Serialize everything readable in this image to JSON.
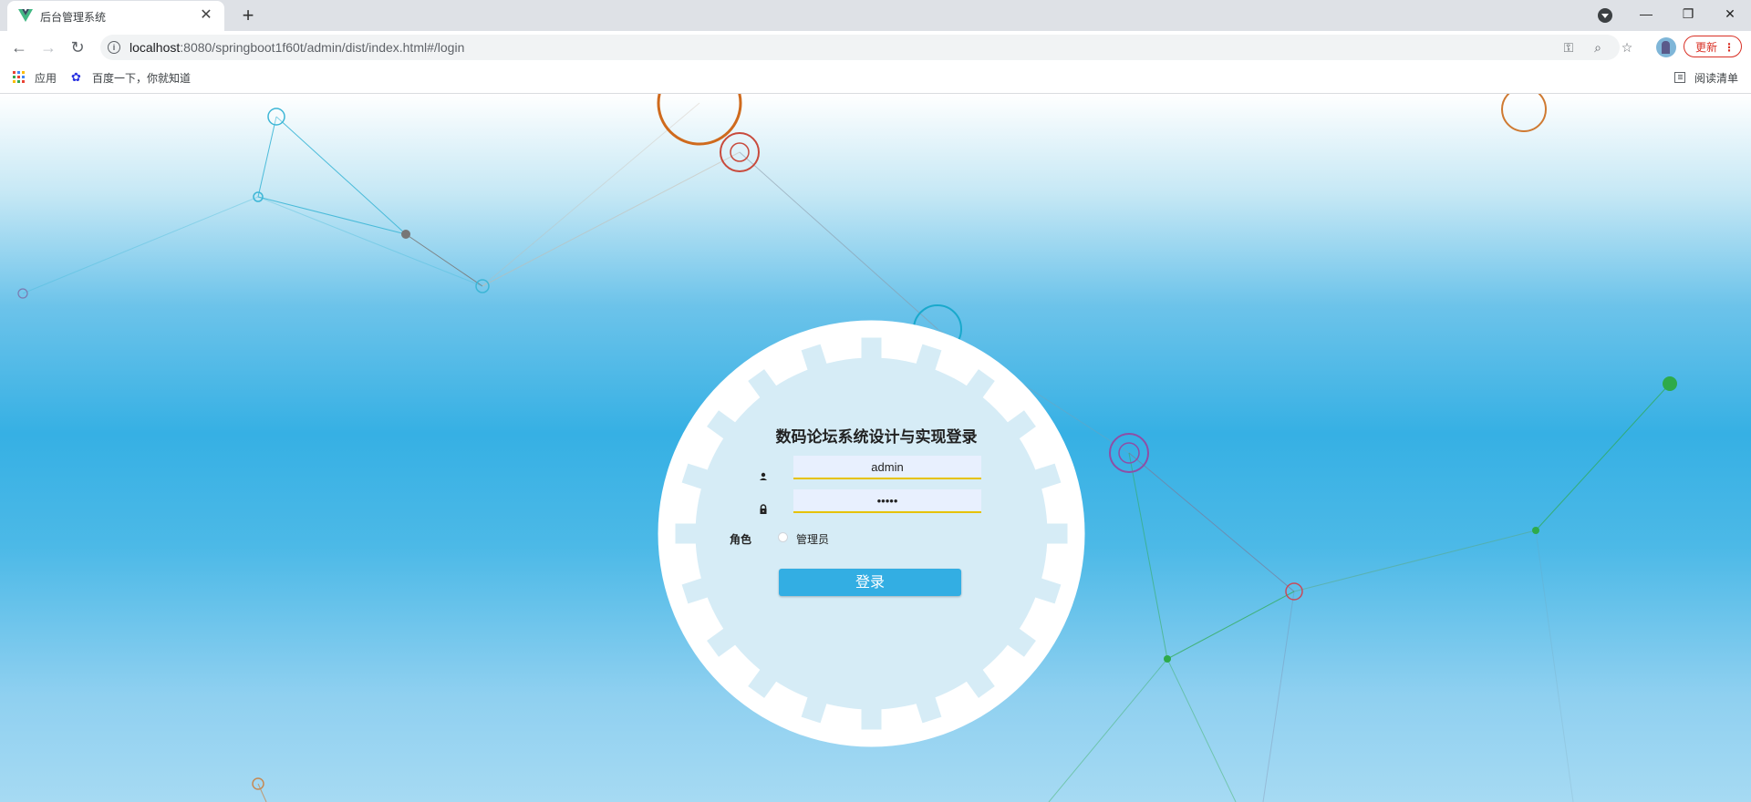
{
  "browser": {
    "tab_title": "后台管理系统",
    "url_host": "localhost",
    "url_path": ":8080/springboot1f60t/admin/dist/index.html#/login",
    "update_label": "更新",
    "bookmarks": [
      {
        "label": "应用",
        "icon": "apps-grid-icon"
      },
      {
        "label": "百度一下，你就知道",
        "icon": "baidu-paw-icon"
      }
    ],
    "reading_list_label": "阅读清单"
  },
  "login": {
    "title": "数码论坛系统设计与实现登录",
    "username_value": "admin",
    "password_value": "•••••",
    "role_label": "角色",
    "role_options": [
      "管理员"
    ],
    "submit_label": "登录"
  },
  "colors": {
    "accent": "#33aee3",
    "input_bg": "#e8f0fe",
    "input_underline": "#e6c200",
    "update_red": "#d93025"
  }
}
